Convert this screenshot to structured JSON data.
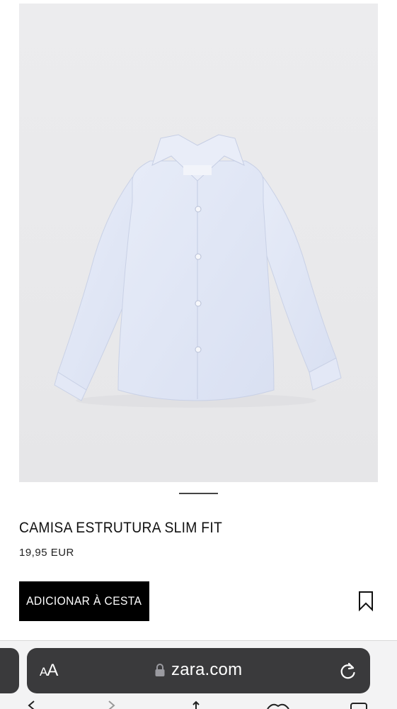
{
  "product": {
    "title": "CAMISA ESTRUTURA SLIM FIT",
    "price": "19,95 EUR",
    "image_alt": "light blue long sleeve shirt",
    "colors": {
      "shirt": "#dfe5f4",
      "background": "#eaeaec"
    }
  },
  "actions": {
    "add_to_cart_label": "ADICIONAR À CESTA",
    "bookmark_icon": "bookmark-icon"
  },
  "carousel": {
    "current_index": 1
  },
  "browser": {
    "text_size_label_small": "A",
    "text_size_label_large": "A",
    "url": "zara.com",
    "lock_icon": "lock-icon",
    "reload_icon": "reload-icon",
    "toolbar_icons": [
      "back-icon",
      "forward-icon",
      "share-icon",
      "bookmarks-icon",
      "tabs-icon"
    ]
  },
  "theme": {
    "button_bg": "#000000",
    "button_text": "#ffffff",
    "address_bar_bg": "#3a3a3c"
  }
}
